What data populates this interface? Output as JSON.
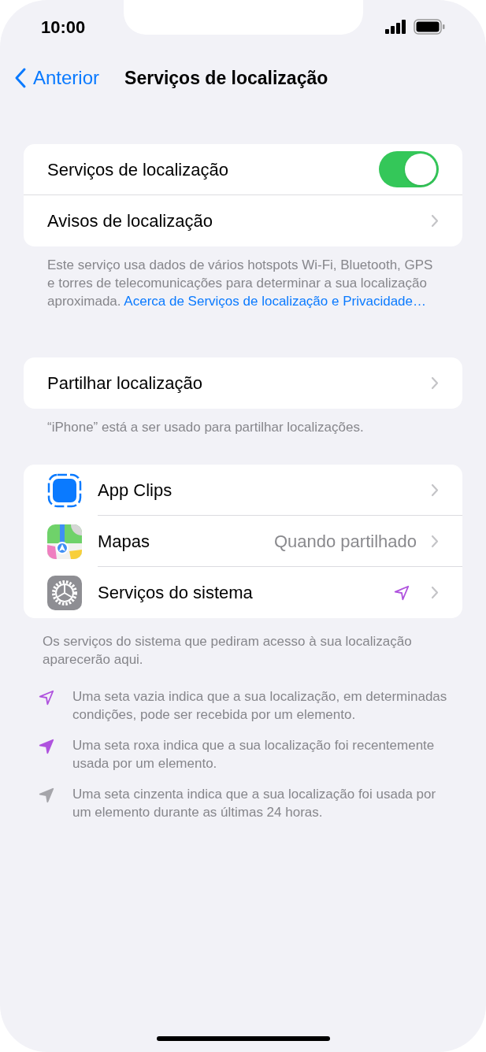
{
  "status_bar": {
    "time": "10:00"
  },
  "nav": {
    "back": "Anterior",
    "title": "Serviços de localização"
  },
  "group1": {
    "rows": [
      {
        "kind": "toggle",
        "label": "Serviços de localização",
        "on": true
      },
      {
        "kind": "link",
        "label": "Avisos de localização"
      }
    ],
    "footer": "Este serviço usa dados de vários hotspots Wi‑Fi, Bluetooth, GPS e torres de telecomunicações para determinar a sua localização aproximada.",
    "footer_link": "Acerca de Serviços de localização e Privacidade…"
  },
  "group2": {
    "rows": [
      {
        "kind": "link",
        "label": "Partilhar localização"
      }
    ],
    "footer": "“iPhone” está a ser usado para partilhar localizações."
  },
  "apps": {
    "rows": [
      {
        "kind": "appclips",
        "label": "App Clips"
      },
      {
        "kind": "maps",
        "label": "Mapas",
        "value": "Quando partilhado"
      },
      {
        "kind": "settings",
        "label": "Serviços do sistema",
        "location_arrow": true
      }
    ],
    "footer": "Os serviços do sistema que pediram acesso à sua localização aparecerão aqui."
  },
  "legend": [
    {
      "kind": "outline",
      "color": "#af52de",
      "text": "Uma seta vazia indica que a sua localização, em determinadas condições, pode ser recebida por um elemento."
    },
    {
      "kind": "filled",
      "color": "#af52de",
      "text": "Uma seta roxa indica que a sua localização foi recentemente usada por um elemento."
    },
    {
      "kind": "filled",
      "color": "#a5a5aa",
      "text": "Uma seta cinzenta indica que a sua localização foi usada por um elemento durante as últimas 24 horas."
    }
  ]
}
